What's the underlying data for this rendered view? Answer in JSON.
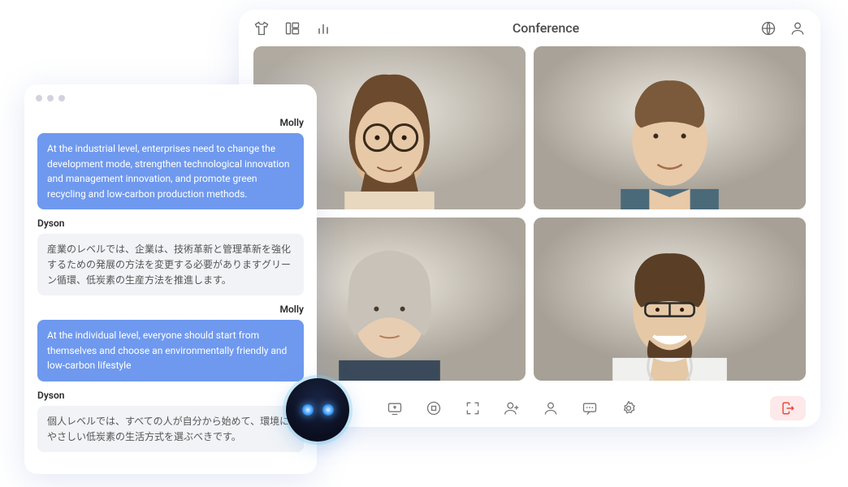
{
  "conference": {
    "title": "Conference",
    "header_icons": [
      "shirt-icon",
      "layout-icon",
      "stats-icon"
    ],
    "right_icons": [
      "globe-icon",
      "user-icon"
    ],
    "participants": [
      "participant-1",
      "participant-2",
      "participant-3",
      "participant-4"
    ],
    "footer_icons": [
      "share-screen-icon",
      "record-icon",
      "fullscreen-icon",
      "add-user-icon",
      "participants-icon",
      "chat-icon",
      "settings-icon"
    ],
    "leave_icon": "leave-icon"
  },
  "chat": {
    "messages": [
      {
        "sender": "Molly",
        "align": "right",
        "style": "blue",
        "text": "At the industrial level, enterprises need to change the development mode, strengthen technological innovation and management innovation, and promote green recycling and low-carbon production methods."
      },
      {
        "sender": "Dyson",
        "align": "left",
        "style": "gray",
        "text": "産業のレベルでは、企業は、技術革新と管理革新を強化するための発展の方法を変更する必要がありますグリーン循環、低炭素の生産方法を推進します。"
      },
      {
        "sender": "Molly",
        "align": "right",
        "style": "blue",
        "text": "At the individual level, everyone should start from themselves and choose an environmentally friendly and low-carbon lifestyle"
      },
      {
        "sender": "Dyson",
        "align": "left",
        "style": "gray",
        "text": "個人レベルでは、すべての人が自分から始めて、環境にやさしい低炭素の生活方式を選ぶべきです。"
      }
    ]
  },
  "bot": {
    "name": "assistant-bot"
  }
}
